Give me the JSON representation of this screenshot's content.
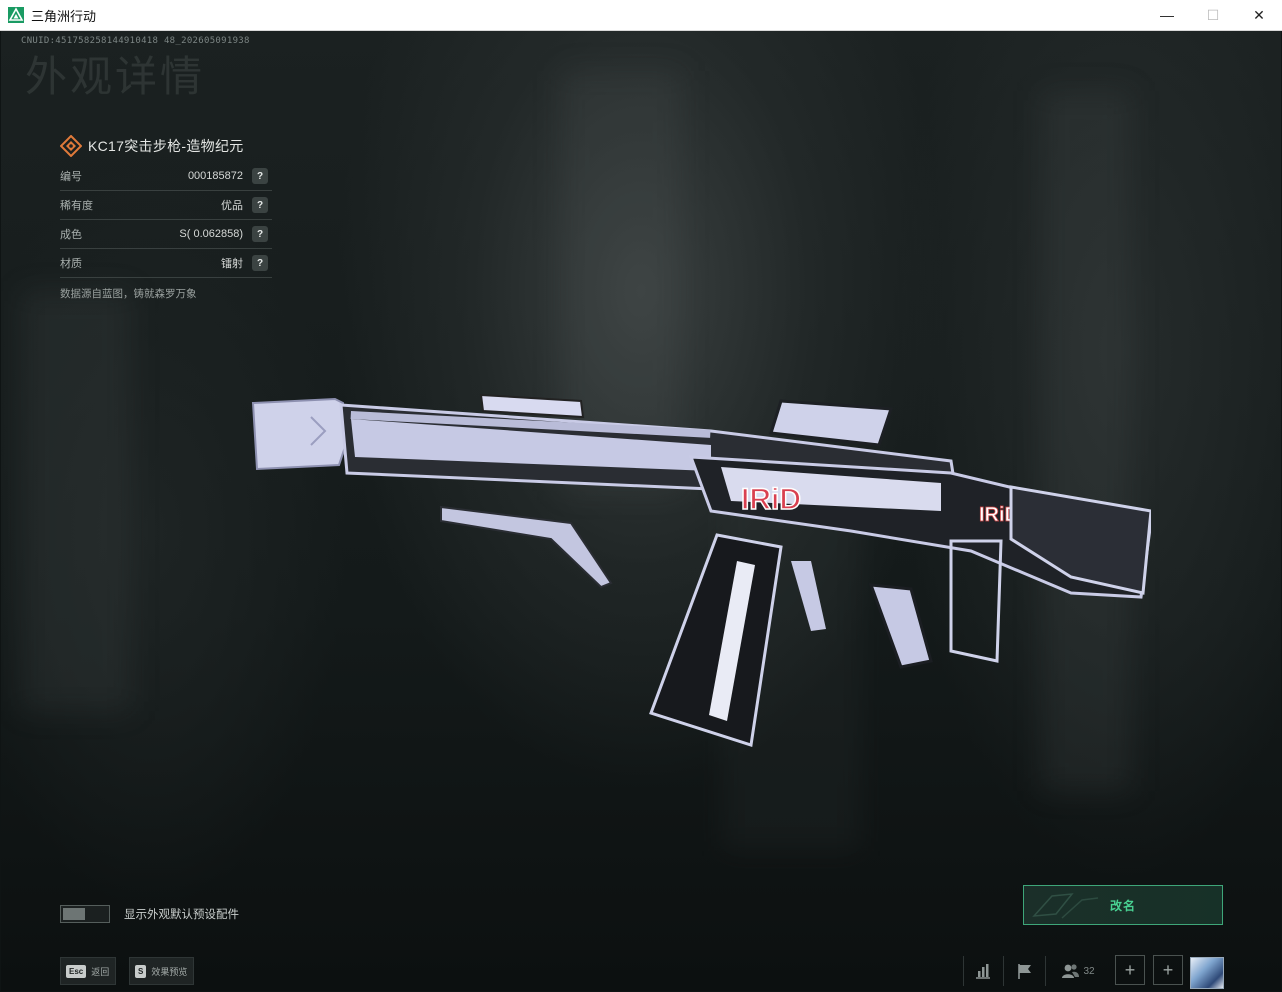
{
  "window": {
    "title": "三角洲行动",
    "minimize": "—",
    "maximize": "☐",
    "close": "✕"
  },
  "uid": "CNUID:451758258144910418 48_202605091938",
  "page_title": "外观详情",
  "item": {
    "name": "KC17突击步枪-造物纪元",
    "attributes": [
      {
        "label": "编号",
        "value": "000185872"
      },
      {
        "label": "稀有度",
        "value": "优品"
      },
      {
        "label": "成色",
        "value": "S( 0.062858)"
      },
      {
        "label": "材质",
        "value": "镭射"
      }
    ],
    "help": "?",
    "description": "数据源自蓝图，铸就森罗万象",
    "rarity_color": "#e07a3a"
  },
  "toggle": {
    "label": "显示外观默认预设配件",
    "on": false
  },
  "rename_button": "改名",
  "hints": [
    {
      "key": "Esc",
      "label": "返回"
    },
    {
      "key": "S",
      "label": "效果预览"
    }
  ],
  "tray": {
    "stats_icon": "bar-chart-icon",
    "flag_icon": "flag-icon",
    "friends_icon": "friends-icon",
    "friends_count": "32",
    "plus": "+"
  },
  "colors": {
    "accent_green": "#49d192",
    "rename_border": "#3ea679",
    "app_icon": "#1a9b63"
  }
}
